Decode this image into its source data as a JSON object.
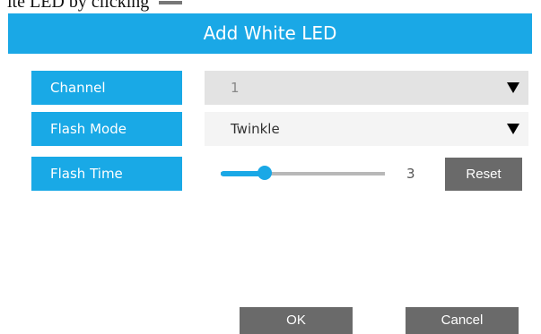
{
  "page": {
    "top_fragment": "ite LED by clicking"
  },
  "dialog": {
    "title": "Add White LED",
    "fields": {
      "channel": {
        "label": "Channel",
        "value": "1"
      },
      "flash_mode": {
        "label": "Flash Mode",
        "value": "Twinkle"
      },
      "flash_time": {
        "label": "Flash Time",
        "value": "3",
        "slider_fraction": 0.27,
        "reset_label": "Reset"
      }
    },
    "buttons": {
      "ok_label": "OK",
      "cancel_label": "Cancel"
    }
  },
  "colors": {
    "accent": "#1aa8e6",
    "button_gray": "#6a6a6a",
    "select_gray": "#e3e3e3"
  },
  "icons": {
    "dropdown": "triangle-down-icon",
    "inline_button": "button-icon"
  }
}
